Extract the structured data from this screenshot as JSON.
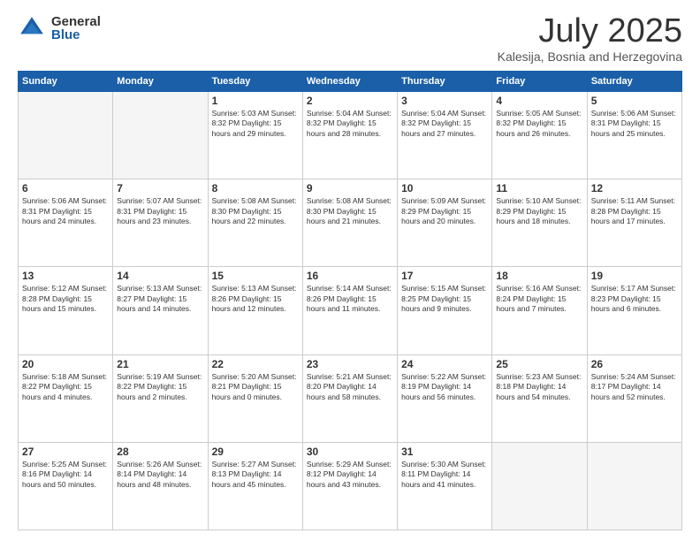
{
  "logo": {
    "general": "General",
    "blue": "Blue"
  },
  "title": "July 2025",
  "location": "Kalesija, Bosnia and Herzegovina",
  "weekdays": [
    "Sunday",
    "Monday",
    "Tuesday",
    "Wednesday",
    "Thursday",
    "Friday",
    "Saturday"
  ],
  "days": [
    {
      "date": "",
      "info": ""
    },
    {
      "date": "",
      "info": ""
    },
    {
      "date": "1",
      "info": "Sunrise: 5:03 AM\nSunset: 8:32 PM\nDaylight: 15 hours and 29 minutes."
    },
    {
      "date": "2",
      "info": "Sunrise: 5:04 AM\nSunset: 8:32 PM\nDaylight: 15 hours and 28 minutes."
    },
    {
      "date": "3",
      "info": "Sunrise: 5:04 AM\nSunset: 8:32 PM\nDaylight: 15 hours and 27 minutes."
    },
    {
      "date": "4",
      "info": "Sunrise: 5:05 AM\nSunset: 8:32 PM\nDaylight: 15 hours and 26 minutes."
    },
    {
      "date": "5",
      "info": "Sunrise: 5:06 AM\nSunset: 8:31 PM\nDaylight: 15 hours and 25 minutes."
    },
    {
      "date": "6",
      "info": "Sunrise: 5:06 AM\nSunset: 8:31 PM\nDaylight: 15 hours and 24 minutes."
    },
    {
      "date": "7",
      "info": "Sunrise: 5:07 AM\nSunset: 8:31 PM\nDaylight: 15 hours and 23 minutes."
    },
    {
      "date": "8",
      "info": "Sunrise: 5:08 AM\nSunset: 8:30 PM\nDaylight: 15 hours and 22 minutes."
    },
    {
      "date": "9",
      "info": "Sunrise: 5:08 AM\nSunset: 8:30 PM\nDaylight: 15 hours and 21 minutes."
    },
    {
      "date": "10",
      "info": "Sunrise: 5:09 AM\nSunset: 8:29 PM\nDaylight: 15 hours and 20 minutes."
    },
    {
      "date": "11",
      "info": "Sunrise: 5:10 AM\nSunset: 8:29 PM\nDaylight: 15 hours and 18 minutes."
    },
    {
      "date": "12",
      "info": "Sunrise: 5:11 AM\nSunset: 8:28 PM\nDaylight: 15 hours and 17 minutes."
    },
    {
      "date": "13",
      "info": "Sunrise: 5:12 AM\nSunset: 8:28 PM\nDaylight: 15 hours and 15 minutes."
    },
    {
      "date": "14",
      "info": "Sunrise: 5:13 AM\nSunset: 8:27 PM\nDaylight: 15 hours and 14 minutes."
    },
    {
      "date": "15",
      "info": "Sunrise: 5:13 AM\nSunset: 8:26 PM\nDaylight: 15 hours and 12 minutes."
    },
    {
      "date": "16",
      "info": "Sunrise: 5:14 AM\nSunset: 8:26 PM\nDaylight: 15 hours and 11 minutes."
    },
    {
      "date": "17",
      "info": "Sunrise: 5:15 AM\nSunset: 8:25 PM\nDaylight: 15 hours and 9 minutes."
    },
    {
      "date": "18",
      "info": "Sunrise: 5:16 AM\nSunset: 8:24 PM\nDaylight: 15 hours and 7 minutes."
    },
    {
      "date": "19",
      "info": "Sunrise: 5:17 AM\nSunset: 8:23 PM\nDaylight: 15 hours and 6 minutes."
    },
    {
      "date": "20",
      "info": "Sunrise: 5:18 AM\nSunset: 8:22 PM\nDaylight: 15 hours and 4 minutes."
    },
    {
      "date": "21",
      "info": "Sunrise: 5:19 AM\nSunset: 8:22 PM\nDaylight: 15 hours and 2 minutes."
    },
    {
      "date": "22",
      "info": "Sunrise: 5:20 AM\nSunset: 8:21 PM\nDaylight: 15 hours and 0 minutes."
    },
    {
      "date": "23",
      "info": "Sunrise: 5:21 AM\nSunset: 8:20 PM\nDaylight: 14 hours and 58 minutes."
    },
    {
      "date": "24",
      "info": "Sunrise: 5:22 AM\nSunset: 8:19 PM\nDaylight: 14 hours and 56 minutes."
    },
    {
      "date": "25",
      "info": "Sunrise: 5:23 AM\nSunset: 8:18 PM\nDaylight: 14 hours and 54 minutes."
    },
    {
      "date": "26",
      "info": "Sunrise: 5:24 AM\nSunset: 8:17 PM\nDaylight: 14 hours and 52 minutes."
    },
    {
      "date": "27",
      "info": "Sunrise: 5:25 AM\nSunset: 8:16 PM\nDaylight: 14 hours and 50 minutes."
    },
    {
      "date": "28",
      "info": "Sunrise: 5:26 AM\nSunset: 8:14 PM\nDaylight: 14 hours and 48 minutes."
    },
    {
      "date": "29",
      "info": "Sunrise: 5:27 AM\nSunset: 8:13 PM\nDaylight: 14 hours and 45 minutes."
    },
    {
      "date": "30",
      "info": "Sunrise: 5:29 AM\nSunset: 8:12 PM\nDaylight: 14 hours and 43 minutes."
    },
    {
      "date": "31",
      "info": "Sunrise: 5:30 AM\nSunset: 8:11 PM\nDaylight: 14 hours and 41 minutes."
    },
    {
      "date": "",
      "info": ""
    },
    {
      "date": "",
      "info": ""
    },
    {
      "date": "",
      "info": ""
    },
    {
      "date": "",
      "info": ""
    },
    {
      "date": "",
      "info": ""
    },
    {
      "date": "",
      "info": ""
    },
    {
      "date": "",
      "info": ""
    },
    {
      "date": "",
      "info": ""
    },
    {
      "date": "",
      "info": ""
    },
    {
      "date": "",
      "info": ""
    }
  ]
}
